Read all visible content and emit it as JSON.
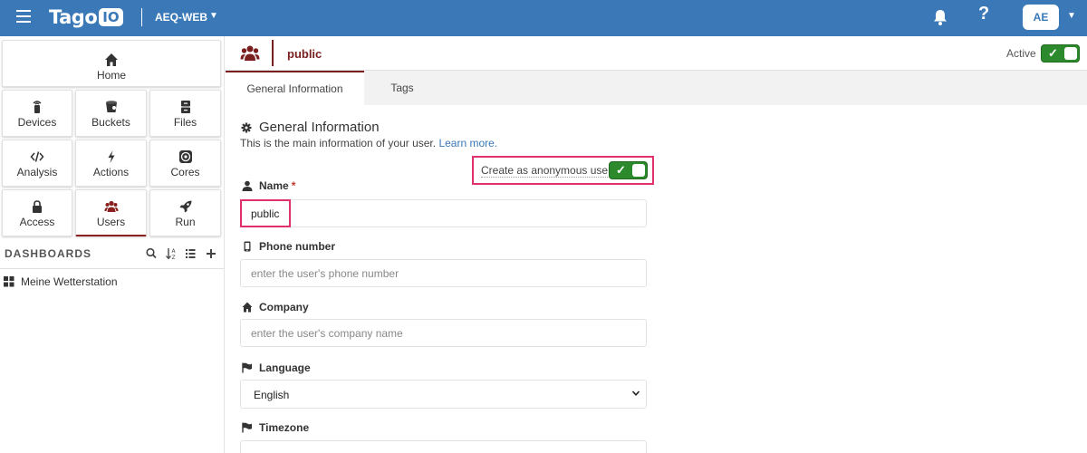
{
  "topbar": {
    "logo_text": "Tago",
    "logo_box": "IO",
    "account": "AEQ-WEB",
    "avatar": "AE",
    "help_icon": "?",
    "color": "#3a78b8"
  },
  "sidebar": {
    "tiles": [
      {
        "label": "Home",
        "icon": "home-icon"
      },
      {
        "label": "Devices",
        "icon": "device-icon"
      },
      {
        "label": "Buckets",
        "icon": "bucket-icon"
      },
      {
        "label": "Files",
        "icon": "files-icon"
      },
      {
        "label": "Analysis",
        "icon": "code-icon"
      },
      {
        "label": "Actions",
        "icon": "bolt-icon"
      },
      {
        "label": "Cores",
        "icon": "cores-icon"
      },
      {
        "label": "Access",
        "icon": "lock-icon"
      },
      {
        "label": "Users",
        "icon": "users-icon"
      },
      {
        "label": "Run",
        "icon": "rocket-icon"
      }
    ],
    "dashboards_heading": "DASHBOARDS",
    "dashboards": [
      {
        "label": "Meine Wetterstation"
      }
    ]
  },
  "header": {
    "title": "public",
    "active_label": "Active",
    "active_toggle_mark": "✓"
  },
  "tabs": [
    {
      "label": "General Information"
    },
    {
      "label": "Tags"
    }
  ],
  "section": {
    "title": "General Information",
    "subtitle": "This is the main information of your user.",
    "learn_more": "Learn more."
  },
  "form": {
    "anonymous_label": "Create as anonymous user",
    "anonymous_toggle_mark": "✓",
    "name_label": "Name",
    "name_required": "*",
    "name_value": "public",
    "phone_label": "Phone number",
    "phone_placeholder": "enter the user's phone number",
    "company_label": "Company",
    "company_placeholder": "enter the user's company name",
    "language_label": "Language",
    "language_value": "English",
    "timezone_label": "Timezone"
  },
  "colors": {
    "accent_dark_red": "#7a1f1f",
    "toggle_green": "#2c8a2c",
    "highlight_pink": "#e0306e"
  }
}
